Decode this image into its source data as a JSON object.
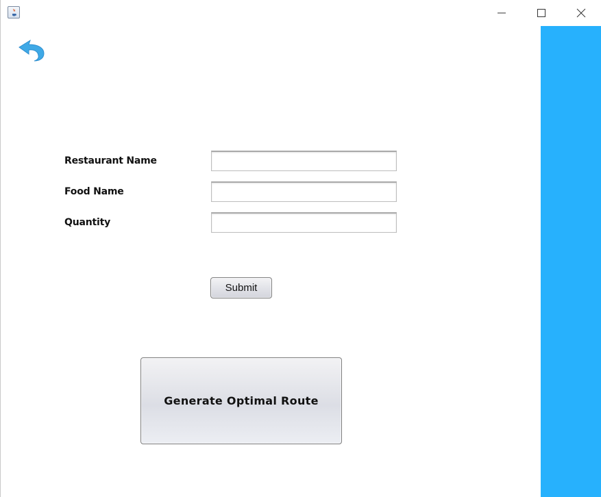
{
  "window": {
    "controls": {
      "minimize_icon": "minimize-icon",
      "maximize_icon": "maximize-icon",
      "close_icon": "close-icon"
    },
    "app_icon": "java-app-icon"
  },
  "navigation": {
    "back_icon": "back-arrow-icon",
    "back_color": "#3fa9e6"
  },
  "form": {
    "fields": [
      {
        "label": "Restaurant Name",
        "value": ""
      },
      {
        "label": "Food Name",
        "value": ""
      },
      {
        "label": "Quantity",
        "value": ""
      }
    ],
    "submit_label": "Submit"
  },
  "actions": {
    "generate_label": "Generate Optimal Route"
  },
  "colors": {
    "side_panel": "#27b1fd",
    "background": "#ffffff"
  }
}
